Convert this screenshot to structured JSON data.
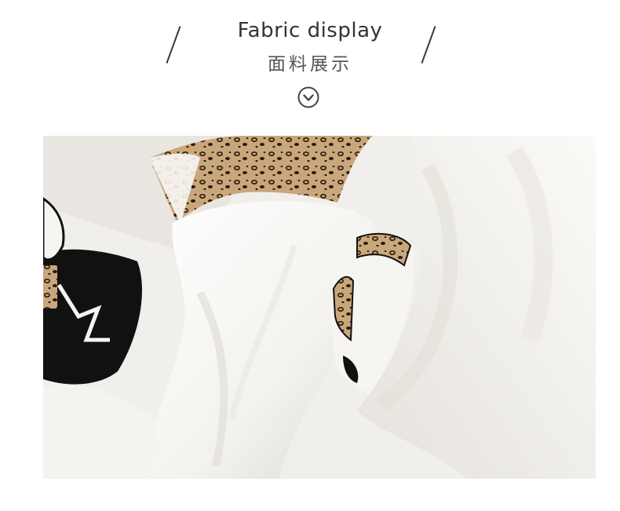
{
  "header": {
    "title_en": "Fabric display",
    "title_cn": "面料展示",
    "chevron_icon": "chevron-down-circle-icon"
  },
  "photo": {
    "subject": "fabric-closeup",
    "colors": {
      "fabric": "#f6f5f2",
      "shadow": "#d9d6d0",
      "print_black": "#111111",
      "leopard_base": "#c9a77a",
      "leopard_spot": "#2a1a10"
    }
  }
}
